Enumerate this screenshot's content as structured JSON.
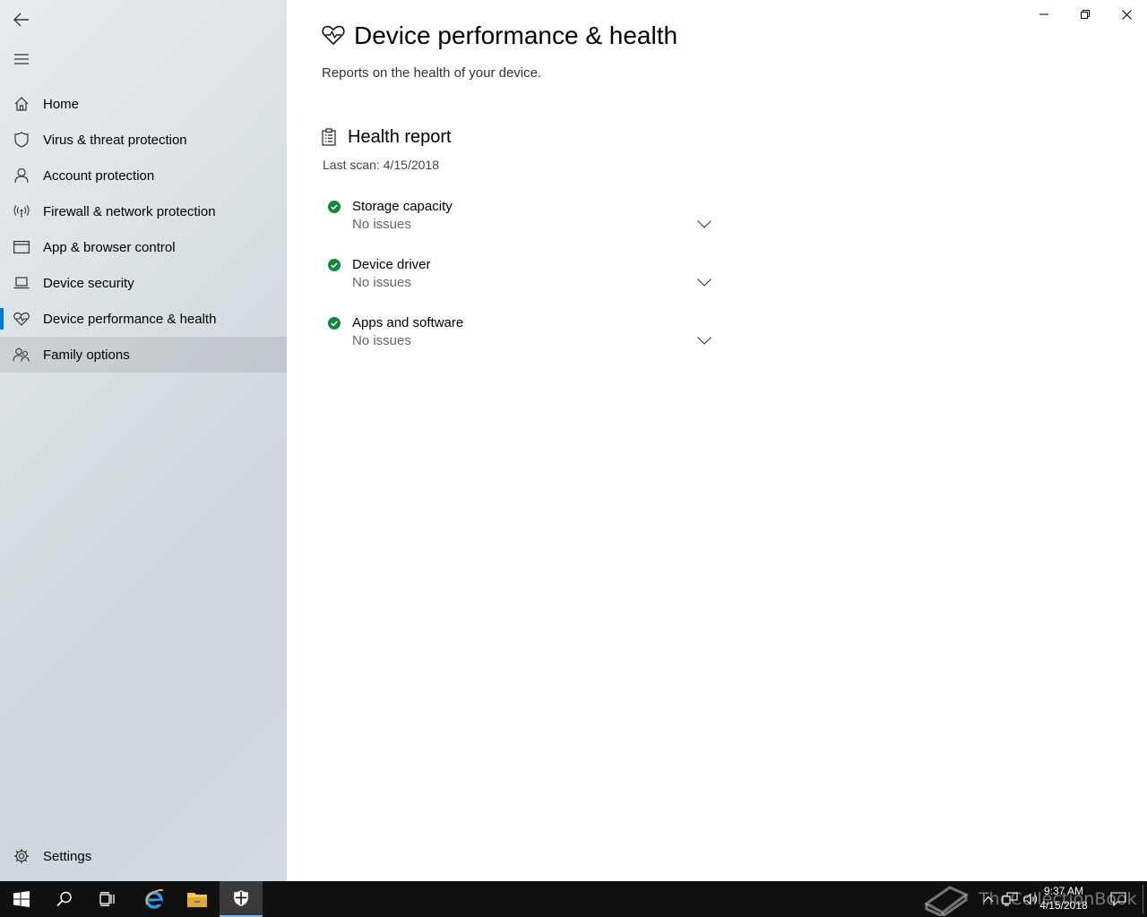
{
  "sidebar": {
    "items": [
      {
        "label": "Home",
        "icon": "home-icon"
      },
      {
        "label": "Virus & threat protection",
        "icon": "shield-icon"
      },
      {
        "label": "Account protection",
        "icon": "person-icon"
      },
      {
        "label": "Firewall & network protection",
        "icon": "wireless-icon"
      },
      {
        "label": "App & browser control",
        "icon": "browser-window-icon"
      },
      {
        "label": "Device security",
        "icon": "laptop-icon"
      },
      {
        "label": "Device performance & health",
        "icon": "heart-pulse-icon",
        "selected": true
      },
      {
        "label": "Family options",
        "icon": "family-icon",
        "hovered": true
      }
    ],
    "settings_label": "Settings"
  },
  "page": {
    "title": "Device performance & health",
    "subtitle": "Reports on the health of your device."
  },
  "health_report": {
    "title": "Health report",
    "last_scan": "Last scan: 4/15/2018",
    "items": [
      {
        "title": "Storage capacity",
        "status": "No issues"
      },
      {
        "title": "Device driver",
        "status": "No issues"
      },
      {
        "title": "Apps and software",
        "status": "No issues"
      }
    ]
  },
  "taskbar": {
    "time": "9:37 AM",
    "date": "4/15/2018",
    "watermark": "TheCollectionBook"
  },
  "colors": {
    "accent": "#0078d7",
    "ok_green": "#10893e",
    "taskbar": "#101010"
  }
}
